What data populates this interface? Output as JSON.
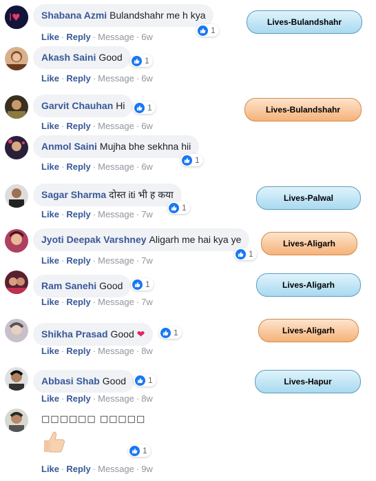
{
  "actions": {
    "like": "Like",
    "reply": "Reply",
    "message": "Message",
    "dot": "·"
  },
  "comments": [
    {
      "author": "Shabana Azmi",
      "text": "Bulandshahr me h kya",
      "reactions": "1",
      "age": "6w",
      "tag": "Lives-Bulandshahr"
    },
    {
      "author": "Akash Saini",
      "text": "Good",
      "reactions": "1",
      "age": "6w"
    },
    {
      "author": "Garvit Chauhan",
      "text": "Hi",
      "reactions": "1",
      "age": "6w",
      "tag": "Lives-Bulandshahr"
    },
    {
      "author": "Anmol Saini",
      "text": "Mujha bhe sekhna hii",
      "reactions": "1",
      "age": "6w"
    },
    {
      "author": "Sagar Sharma",
      "text": "दोस्त iti भी ह कया",
      "reactions": "1",
      "age": "7w",
      "tag": "Lives-Palwal"
    },
    {
      "author": "Jyoti Deepak Varshney",
      "text": "Aligarh me hai kya ye",
      "reactions": "1",
      "age": "7w",
      "tag": "Lives-Aligarh"
    },
    {
      "author": "Ram Sanehi",
      "text": "Good",
      "reactions": "1",
      "age": "7w",
      "tag": "Lives-Aligarh"
    },
    {
      "author": "Shikha Prasad",
      "text": "Good",
      "reactions": "1",
      "age": "8w",
      "tag": "Lives-Aligarh"
    },
    {
      "author": "Abbasi Shab",
      "text": "Good",
      "reactions": "1",
      "age": "8w",
      "tag": "Lives-Hapur"
    },
    {
      "author": "",
      "text": "□□□□□□ □□□□□",
      "reactions": "1",
      "age": "9w"
    }
  ],
  "colors": {
    "link": "#385898",
    "like_blue": "#1877f2",
    "bubble": "#f0f2f5",
    "meta": "#90949c"
  }
}
